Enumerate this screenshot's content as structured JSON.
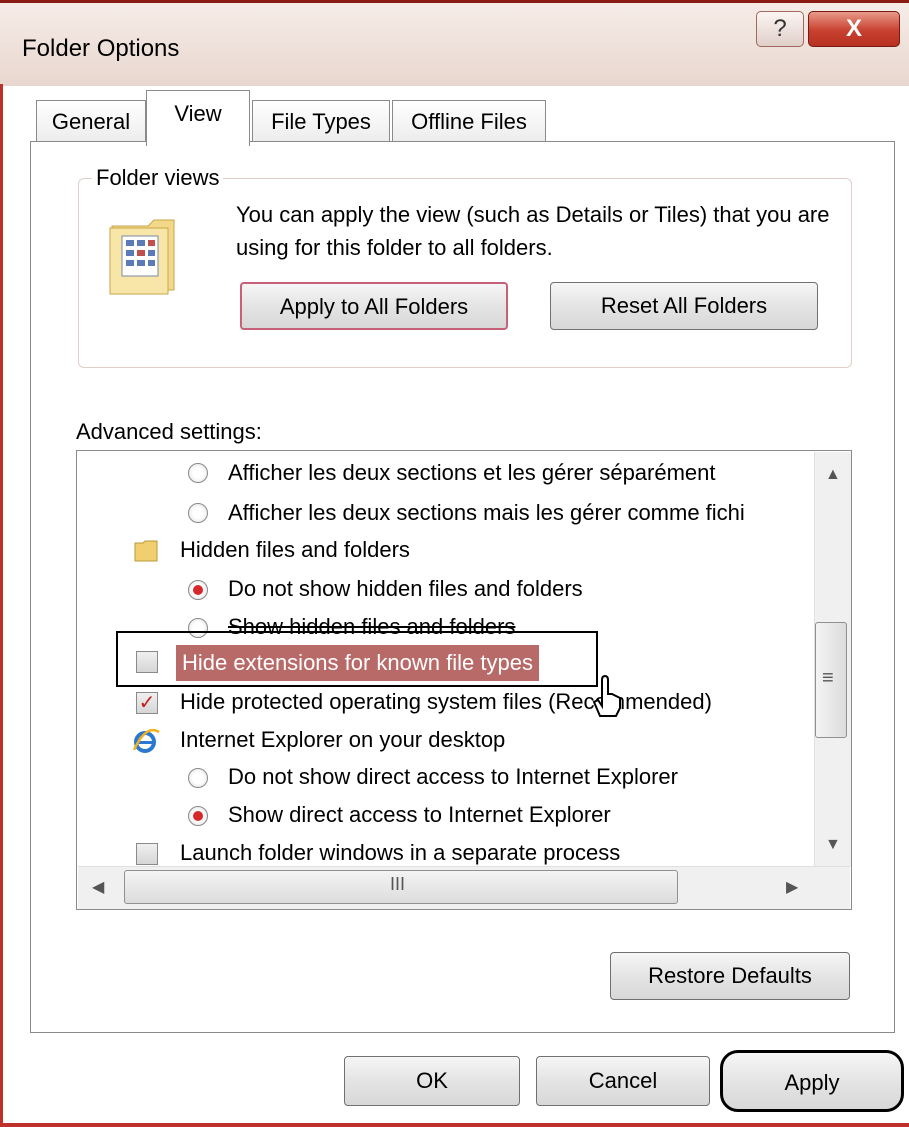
{
  "window": {
    "title": "Folder Options",
    "help_label": "?",
    "close_label": "X"
  },
  "tabs": [
    {
      "label": "General",
      "active": false
    },
    {
      "label": "View",
      "active": true
    },
    {
      "label": "File Types",
      "active": false
    },
    {
      "label": "Offline Files",
      "active": false
    }
  ],
  "folder_views": {
    "label": "Folder views",
    "description": "You can apply the view (such as Details or Tiles) that you are using for this folder to all folders.",
    "apply_all_label": "Apply to All Folders",
    "reset_all_label": "Reset All Folders"
  },
  "advanced": {
    "label": "Advanced settings:",
    "items": [
      {
        "type": "radio",
        "checked": false,
        "label": "Afficher les deux sections et les gérer séparément"
      },
      {
        "type": "radio",
        "checked": false,
        "label": "Afficher les deux sections mais les gérer comme fichi"
      },
      {
        "type": "folder",
        "label": "Hidden files and folders"
      },
      {
        "type": "radio",
        "checked": true,
        "label": "Do not show hidden files and folders"
      },
      {
        "type": "radio",
        "checked": false,
        "label": "Show hidden files and folders"
      },
      {
        "type": "checkbox",
        "checked": false,
        "label": "Hide extensions for known file types",
        "selected": true
      },
      {
        "type": "checkbox",
        "checked": true,
        "label": "Hide protected operating system files (Recommended)"
      },
      {
        "type": "ie",
        "label": "Internet Explorer on your desktop"
      },
      {
        "type": "radio",
        "checked": false,
        "label": "Do not show direct access to Internet Explorer"
      },
      {
        "type": "radio",
        "checked": true,
        "label": "Show direct access to Internet Explorer"
      },
      {
        "type": "checkbox",
        "checked": false,
        "label": "Launch folder windows in a separate process"
      }
    ],
    "hscroll_grip": "III",
    "vscroll_grip": "≡"
  },
  "buttons": {
    "restore_defaults": "Restore Defaults",
    "ok": "OK",
    "cancel": "Cancel",
    "apply": "Apply"
  },
  "colors": {
    "frame": "#c0302a",
    "selection": "#b86a68",
    "radio_on": "#d6282a"
  }
}
